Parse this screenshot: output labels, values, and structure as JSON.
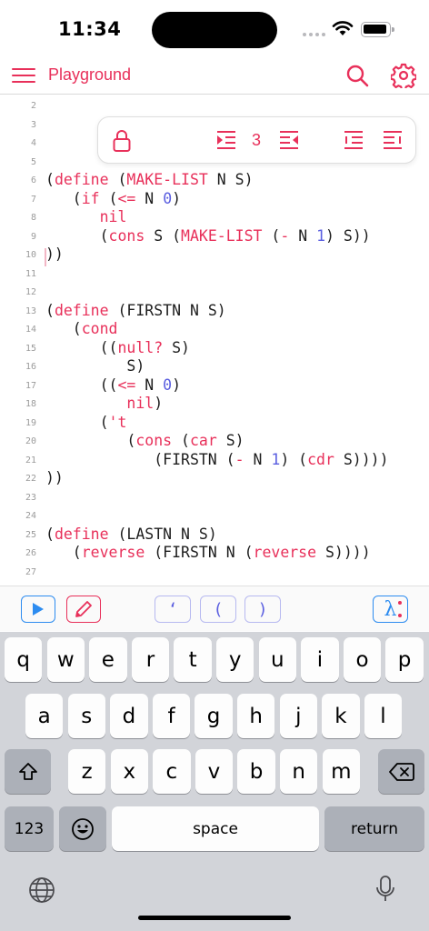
{
  "status_bar": {
    "time": "11:34"
  },
  "nav": {
    "title": "Playground"
  },
  "toolbar": {
    "indent_count": "3"
  },
  "editor": {
    "lines": [
      {
        "n": "2",
        "tokens": []
      },
      {
        "n": "3",
        "tokens": []
      },
      {
        "n": "4",
        "tokens": []
      },
      {
        "n": "5",
        "tokens": []
      },
      {
        "n": "6",
        "tokens": [
          [
            "(",
            "p"
          ],
          [
            "define",
            "k"
          ],
          [
            " (",
            "p"
          ],
          [
            "MAKE-LIST",
            "k"
          ],
          [
            " N S)",
            "p"
          ]
        ]
      },
      {
        "n": "7",
        "tokens": [
          [
            "   (",
            "p"
          ],
          [
            "if",
            "k"
          ],
          [
            " (",
            "p"
          ],
          [
            "<=",
            "k"
          ],
          [
            " N ",
            "p"
          ],
          [
            "0",
            "n"
          ],
          [
            ")",
            "p"
          ]
        ]
      },
      {
        "n": "8",
        "tokens": [
          [
            "      ",
            "p"
          ],
          [
            "nil",
            "k"
          ]
        ]
      },
      {
        "n": "9",
        "tokens": [
          [
            "      (",
            "p"
          ],
          [
            "cons",
            "k"
          ],
          [
            " S (",
            "p"
          ],
          [
            "MAKE-LIST",
            "k"
          ],
          [
            " (",
            "p"
          ],
          [
            "-",
            "k"
          ],
          [
            " N ",
            "p"
          ],
          [
            "1",
            "n"
          ],
          [
            ") S))",
            "p"
          ]
        ]
      },
      {
        "n": "10",
        "tokens": [
          [
            "))",
            "p"
          ]
        ]
      },
      {
        "n": "11",
        "tokens": []
      },
      {
        "n": "12",
        "tokens": []
      },
      {
        "n": "13",
        "tokens": [
          [
            "(",
            "p"
          ],
          [
            "define",
            "k"
          ],
          [
            " (FIRSTN N S)",
            "p"
          ]
        ]
      },
      {
        "n": "14",
        "tokens": [
          [
            "   (",
            "p"
          ],
          [
            "cond",
            "k"
          ]
        ]
      },
      {
        "n": "15",
        "tokens": [
          [
            "      ((",
            "p"
          ],
          [
            "null?",
            "k"
          ],
          [
            " S)",
            "p"
          ]
        ]
      },
      {
        "n": "16",
        "tokens": [
          [
            "         S)",
            "p"
          ]
        ]
      },
      {
        "n": "17",
        "tokens": [
          [
            "      ((",
            "p"
          ],
          [
            "<=",
            "k"
          ],
          [
            " N ",
            "p"
          ],
          [
            "0",
            "n"
          ],
          [
            ")",
            "p"
          ]
        ]
      },
      {
        "n": "18",
        "tokens": [
          [
            "         ",
            "p"
          ],
          [
            "nil",
            "k"
          ],
          [
            ")",
            "p"
          ]
        ]
      },
      {
        "n": "19",
        "tokens": [
          [
            "      (",
            "p"
          ],
          [
            "'t",
            "k"
          ]
        ]
      },
      {
        "n": "20",
        "tokens": [
          [
            "         (",
            "p"
          ],
          [
            "cons",
            "k"
          ],
          [
            " (",
            "p"
          ],
          [
            "car",
            "k"
          ],
          [
            " S)",
            "p"
          ]
        ]
      },
      {
        "n": "21",
        "tokens": [
          [
            "            (FIRSTN (",
            "p"
          ],
          [
            "-",
            "k"
          ],
          [
            " N ",
            "p"
          ],
          [
            "1",
            "n"
          ],
          [
            ") (",
            "p"
          ],
          [
            "cdr",
            "k"
          ],
          [
            " S))))",
            "p"
          ]
        ]
      },
      {
        "n": "22",
        "tokens": [
          [
            "))",
            "p"
          ]
        ]
      },
      {
        "n": "23",
        "tokens": []
      },
      {
        "n": "24",
        "tokens": []
      },
      {
        "n": "25",
        "tokens": [
          [
            "(",
            "p"
          ],
          [
            "define",
            "k"
          ],
          [
            " (LASTN N S)",
            "p"
          ]
        ]
      },
      {
        "n": "26",
        "tokens": [
          [
            "   (",
            "p"
          ],
          [
            "reverse",
            "k"
          ],
          [
            " (FIRSTN N (",
            "p"
          ],
          [
            "reverse",
            "k"
          ],
          [
            " S))))",
            "p"
          ]
        ]
      },
      {
        "n": "27",
        "tokens": []
      }
    ]
  },
  "accessory": {
    "quote_label": "‘",
    "open_paren_label": "(",
    "close_paren_label": ")",
    "lambda_label": "λ"
  },
  "keyboard": {
    "row1": [
      "q",
      "w",
      "e",
      "r",
      "t",
      "y",
      "u",
      "i",
      "o",
      "p"
    ],
    "row2": [
      "a",
      "s",
      "d",
      "f",
      "g",
      "h",
      "j",
      "k",
      "l"
    ],
    "row3": [
      "z",
      "x",
      "c",
      "v",
      "b",
      "n",
      "m"
    ],
    "numbers_label": "123",
    "space_label": "space",
    "return_label": "return"
  },
  "colors": {
    "accent": "#e8305a",
    "number": "#5a5ee0",
    "blue": "#2d8cf0"
  }
}
